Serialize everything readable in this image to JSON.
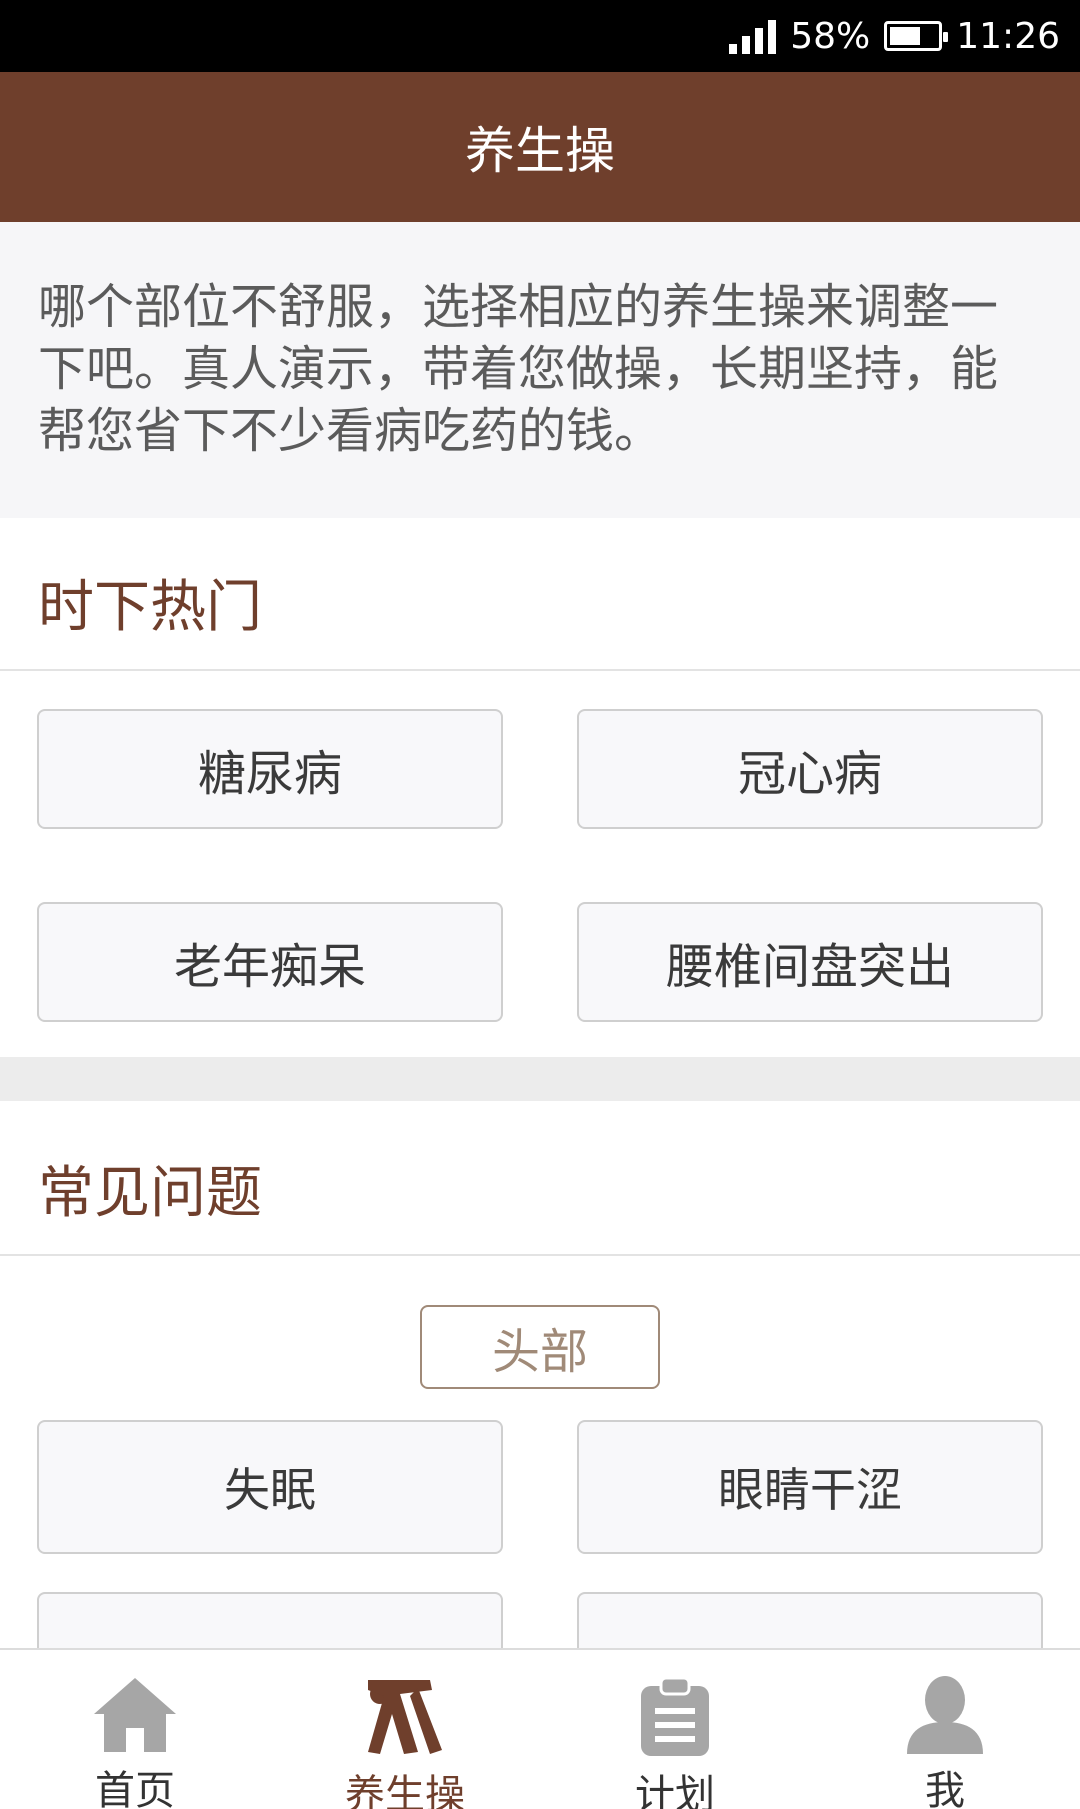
{
  "status_bar": {
    "battery_percent": "58%",
    "time": "11:26",
    "battery_level": 0.58
  },
  "header": {
    "title": "养生操"
  },
  "intro": {
    "text": "哪个部位不舒服，选择相应的养生操来调整一下吧。真人演示，带着您做操，长期坚持，能帮您省下不少看病吃药的钱。"
  },
  "hot": {
    "title": "时下热门",
    "items": [
      "糖尿病",
      "冠心病",
      "老年痴呆",
      "腰椎间盘突出"
    ]
  },
  "common": {
    "title": "常见问题",
    "category": "头部",
    "items": [
      "失眠",
      "眼睛干涩"
    ]
  },
  "nav": {
    "items": [
      {
        "label": "首页",
        "icon": "home-icon"
      },
      {
        "label": "养生操",
        "icon": "exercise-icon"
      },
      {
        "label": "计划",
        "icon": "clipboard-icon"
      },
      {
        "label": "我",
        "icon": "user-icon"
      }
    ],
    "active": 1,
    "active_color": "#6f3f2c",
    "inactive_icon_color": "#a6a6a6"
  },
  "colors": {
    "brand": "#6f3f2c",
    "intro_bg": "#f6f6f8",
    "button_bg": "#f8f8fa"
  }
}
